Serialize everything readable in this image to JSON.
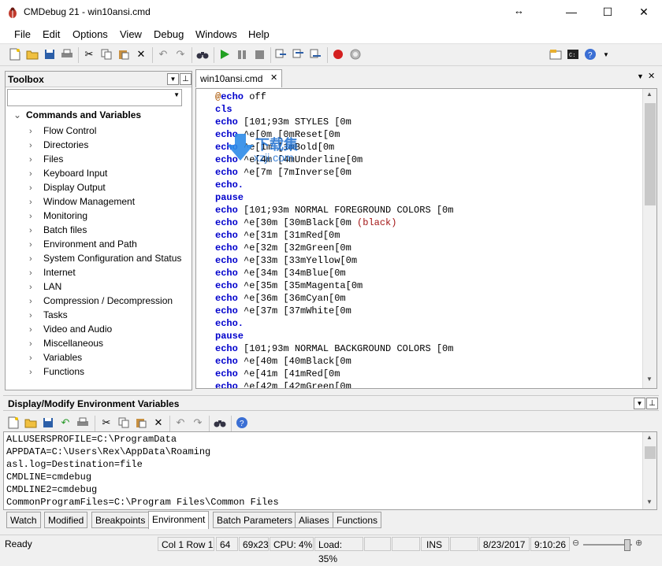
{
  "window": {
    "title": "CMDebug 21 - win10ansi.cmd",
    "minimize": "—",
    "maximize": "☐",
    "close": "✕"
  },
  "menu": [
    "File",
    "Edit",
    "Options",
    "View",
    "Debug",
    "Windows",
    "Help"
  ],
  "toolbox": {
    "title": "Toolbox",
    "root": "Commands and Variables",
    "items": [
      "Flow Control",
      "Directories",
      "Files",
      "Keyboard Input",
      "Display Output",
      "Window Management",
      "Monitoring",
      "Batch files",
      "Environment and Path",
      "System Configuration and Status",
      "Internet",
      "LAN",
      "Compression / Decompression",
      "Tasks",
      "Video and Audio",
      "Miscellaneous",
      "Variables",
      "Functions"
    ]
  },
  "editor": {
    "tab": "win10ansi.cmd",
    "lines": [
      {
        "kw": "@echo",
        "rest": " off"
      },
      {
        "kw": "cls",
        "rest": ""
      },
      {
        "kw": "echo",
        "rest": " [101;93m STYLES [0m"
      },
      {
        "kw": "echo",
        "rest": " ^e[0m [0mReset[0m"
      },
      {
        "kw": "echo",
        "rest": " ^e[1m [1mBold[0m"
      },
      {
        "kw": "echo",
        "rest": " ^e[4m [4mUnderline[0m"
      },
      {
        "kw": "echo",
        "rest": " ^e[7m [7mInverse[0m"
      },
      {
        "kw": "echo.",
        "rest": ""
      },
      {
        "kw": "pause",
        "rest": ""
      },
      {
        "kw": "echo",
        "rest": " [101;93m NORMAL FOREGROUND COLORS [0m"
      },
      {
        "kw": "echo",
        "rest": " ^e[30m [30mBlack[0m ",
        "str": "(black)"
      },
      {
        "kw": "echo",
        "rest": " ^e[31m [31mRed[0m"
      },
      {
        "kw": "echo",
        "rest": " ^e[32m [32mGreen[0m"
      },
      {
        "kw": "echo",
        "rest": " ^e[33m [33mYellow[0m"
      },
      {
        "kw": "echo",
        "rest": " ^e[34m [34mBlue[0m"
      },
      {
        "kw": "echo",
        "rest": " ^e[35m [35mMagenta[0m"
      },
      {
        "kw": "echo",
        "rest": " ^e[36m [36mCyan[0m"
      },
      {
        "kw": "echo",
        "rest": " ^e[37m [37mWhite[0m"
      },
      {
        "kw": "echo.",
        "rest": ""
      },
      {
        "kw": "pause",
        "rest": ""
      },
      {
        "kw": "echo",
        "rest": " [101;93m NORMAL BACKGROUND COLORS [0m"
      },
      {
        "kw": "echo",
        "rest": " ^e[40m [40mBlack[0m"
      },
      {
        "kw": "echo",
        "rest": " ^e[41m [41mRed[0m"
      },
      {
        "kw": "echo",
        "rest": " ^e[42m [42mGreen[0m"
      }
    ]
  },
  "env": {
    "title": "Display/Modify Environment Variables",
    "lines": [
      "ALLUSERSPROFILE=C:\\ProgramData",
      "APPDATA=C:\\Users\\Rex\\AppData\\Roaming",
      "asl.log=Destination=file",
      "CMDLINE=cmdebug",
      "CMDLINE2=cmdebug",
      "CommonProgramFiles=C:\\Program Files\\Common Files"
    ]
  },
  "bottom_tabs": [
    "Watch",
    "Modified",
    "Breakpoints",
    "Environment",
    "Batch Parameters",
    "Aliases",
    "Functions"
  ],
  "active_bottom_tab": "Environment",
  "status": {
    "ready": "Ready",
    "position": "Col 1  Row 1",
    "col": "64",
    "size": "69x23",
    "cpu": "CPU:  4%",
    "load": "Load: 35%",
    "ins": "INS",
    "date": "8/23/2017",
    "time": "9:10:26"
  },
  "watermark": {
    "line1": "下载集",
    "line2": "xzji.com"
  },
  "colors": {
    "keyword": "#0000cc",
    "string": "#a31515",
    "run": "#22a022",
    "record": "#d42020"
  }
}
